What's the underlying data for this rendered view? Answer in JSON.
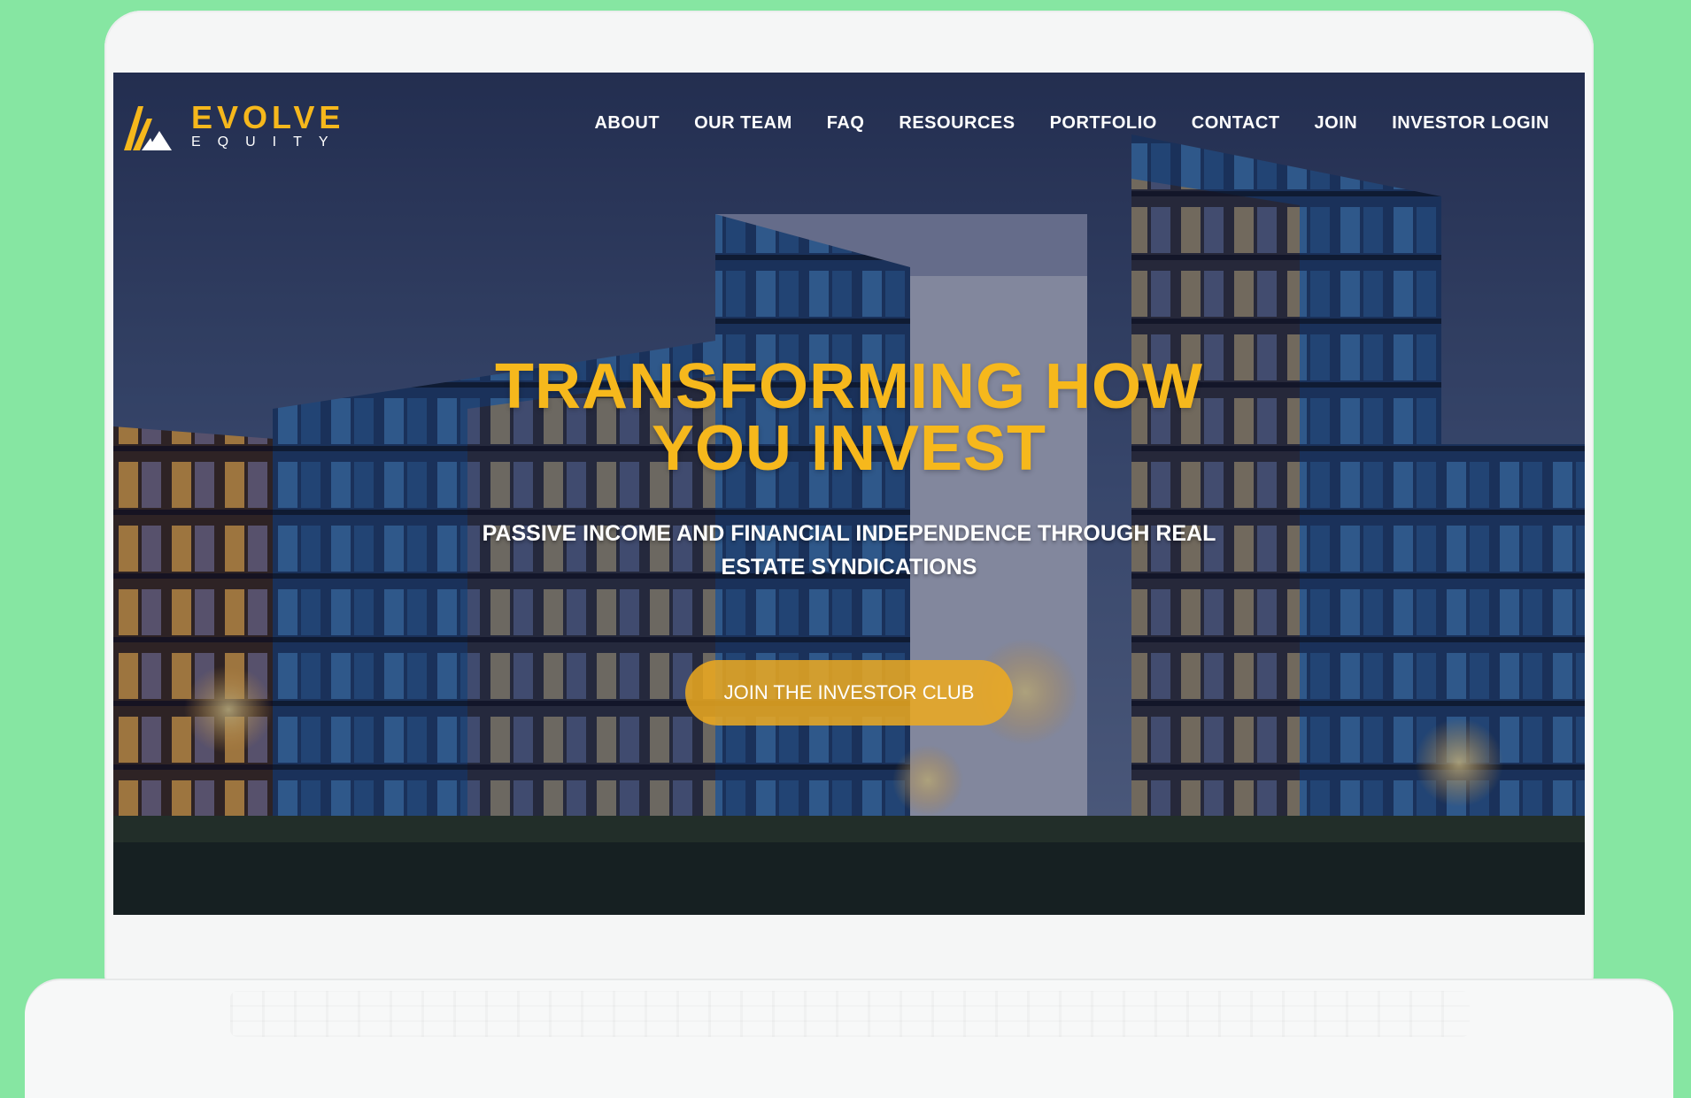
{
  "brand": {
    "name": "EVOLVE",
    "tagline": "EQUITY",
    "primary_color": "#f6b81c",
    "background_color": "#86e6a2"
  },
  "nav": {
    "items": [
      {
        "label": "ABOUT"
      },
      {
        "label": "OUR TEAM"
      },
      {
        "label": "FAQ"
      },
      {
        "label": "RESOURCES"
      },
      {
        "label": "PORTFOLIO"
      },
      {
        "label": "CONTACT"
      },
      {
        "label": "JOIN"
      },
      {
        "label": "INVESTOR LOGIN"
      }
    ]
  },
  "hero": {
    "title_line1": "TRANSFORMING HOW",
    "title_line2": "YOU INVEST",
    "subtitle": "PASSIVE INCOME AND FINANCIAL INDEPENDENCE THROUGH REAL ESTATE SYNDICATIONS",
    "cta_label": "JOIN THE INVESTOR CLUB"
  }
}
